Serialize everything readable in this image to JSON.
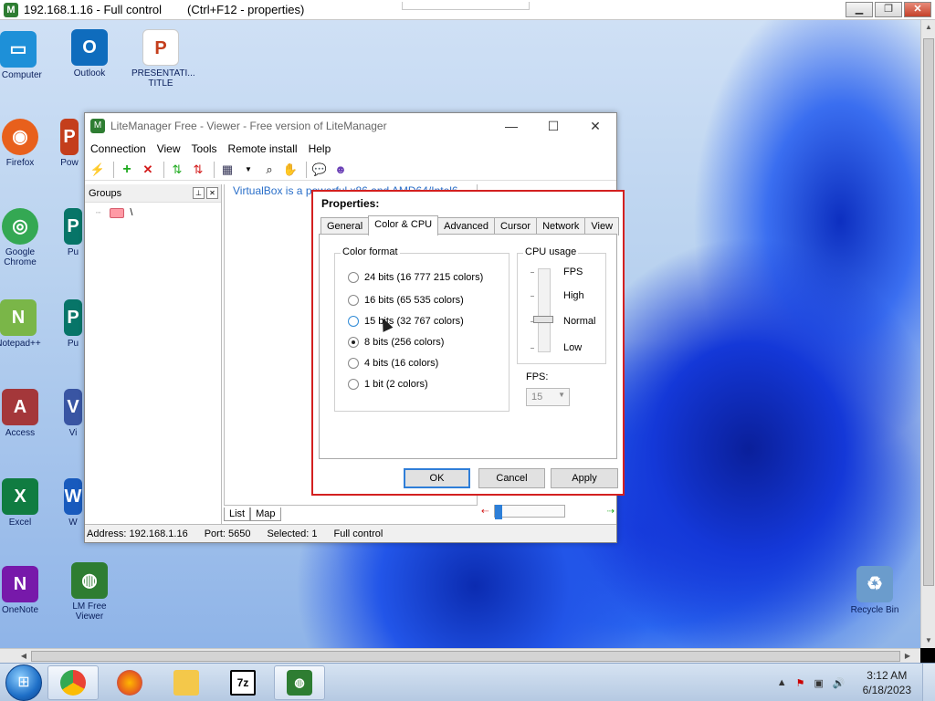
{
  "remote_window": {
    "title": "192.168.1.16  - Full control",
    "shortcut": "(Ctrl+F12 - properties)"
  },
  "desktop_icons": [
    {
      "label": "y Computer",
      "color": "#1e90d8",
      "glyph": "▭"
    },
    {
      "label": "Outlook",
      "color": "#0f6cbd",
      "glyph": "O"
    },
    {
      "label": "PRESENTATI... TITLE",
      "color": "#c43e1c",
      "glyph": "P"
    },
    {
      "label": "Firefox",
      "color": "#e8601c",
      "glyph": "◉"
    },
    {
      "label": "Pow",
      "color": "#c43e1c",
      "glyph": "P"
    },
    {
      "label": "Google Chrome",
      "color": "#34a853",
      "glyph": "◎"
    },
    {
      "label": "Pu",
      "color": "#077568",
      "glyph": "P"
    },
    {
      "label": "Notepad++",
      "color": "#7ab648",
      "glyph": "N"
    },
    {
      "label": "Pu",
      "color": "#077568",
      "glyph": "P"
    },
    {
      "label": "Access",
      "color": "#a4373a",
      "glyph": "A"
    },
    {
      "label": "Vi",
      "color": "#3955a3",
      "glyph": "V"
    },
    {
      "label": "Excel",
      "color": "#107c41",
      "glyph": "X"
    },
    {
      "label": "W",
      "color": "#185abd",
      "glyph": "W"
    },
    {
      "label": "OneNote",
      "color": "#7719aa",
      "glyph": "N"
    },
    {
      "label": "LM Free Viewer",
      "color": "#2e7d32",
      "glyph": "◍"
    },
    {
      "label": "Recycle Bin",
      "color": "#6b9ccc",
      "glyph": "♻"
    }
  ],
  "litemanager": {
    "title": "LiteManager Free - Viewer - Free version of LiteManager",
    "menu": [
      "Connection",
      "View",
      "Tools",
      "Remote install",
      "Help"
    ],
    "groups_header": "Groups",
    "tree_root": "\\",
    "banner": "VirtualBox is a powerful x86 and AMD64/Intel6",
    "bottom_tabs": [
      "List",
      "Map"
    ],
    "status": {
      "address": "Address: 192.168.1.16",
      "port": "Port: 5650",
      "selected": "Selected: 1",
      "mode": "Full control"
    }
  },
  "properties": {
    "title": "Properties:",
    "tabs": [
      "General",
      "Color & CPU",
      "Advanced",
      "Cursor",
      "Network",
      "View"
    ],
    "active_tab": "Color & CPU",
    "color_format": {
      "label": "Color format",
      "options": [
        "24 bits (16 777 215 colors)",
        "16 bits (65 535 colors)",
        "15 bits (32 767 colors)",
        "8 bits (256 colors)",
        "4 bits (16 colors)",
        "1 bit (2 colors)"
      ],
      "selected": "8 bits (256 colors)"
    },
    "cpu_usage": {
      "label": "CPU usage",
      "levels": [
        "FPS",
        "High",
        "Normal",
        "Low"
      ],
      "selected": "Normal"
    },
    "fps": {
      "label": "FPS:",
      "value": "15"
    },
    "buttons": {
      "ok": "OK",
      "cancel": "Cancel",
      "apply": "Apply"
    }
  },
  "taskbar": {
    "time": "3:12 AM",
    "date": "6/18/2023",
    "apps": [
      "chrome-icon",
      "firefox-icon",
      "file-explorer-icon",
      "7zip-icon",
      "litemanager-icon"
    ],
    "sevenzip_label": "7z"
  }
}
